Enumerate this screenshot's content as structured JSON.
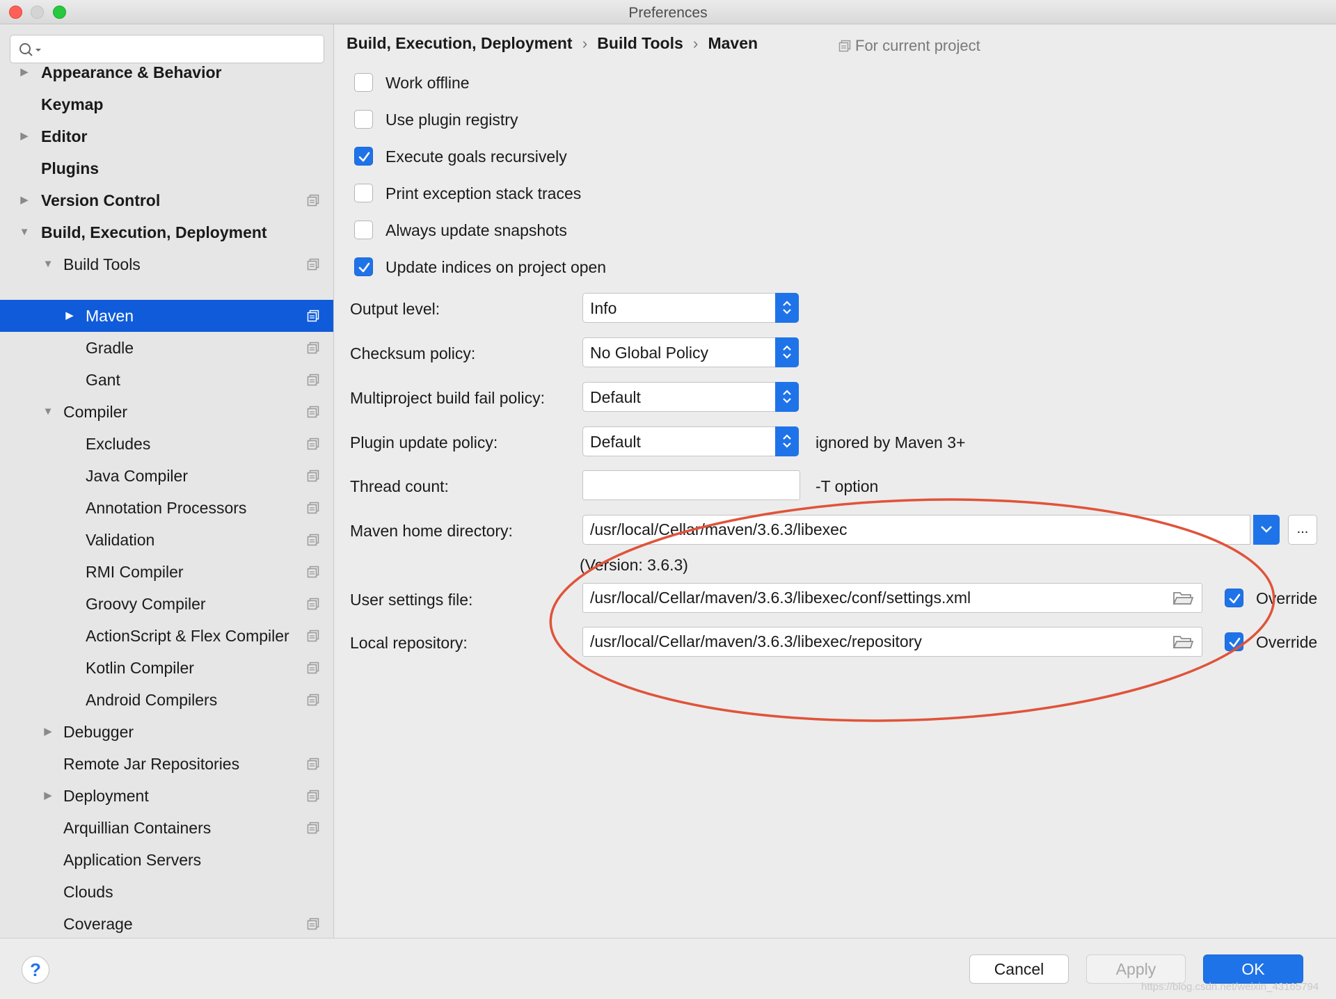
{
  "window": {
    "title": "Preferences"
  },
  "sidebar": {
    "search": {
      "placeholder": ""
    },
    "items": [
      {
        "label": "Appearance & Behavior"
      },
      {
        "label": "Keymap"
      },
      {
        "label": "Editor"
      },
      {
        "label": "Plugins"
      },
      {
        "label": "Version Control"
      },
      {
        "label": "Build, Execution, Deployment"
      },
      {
        "label": "Build Tools"
      },
      {
        "label": "Maven"
      },
      {
        "label": "Gradle"
      },
      {
        "label": "Gant"
      },
      {
        "label": "Compiler"
      },
      {
        "label": "Excludes"
      },
      {
        "label": "Java Compiler"
      },
      {
        "label": "Annotation Processors"
      },
      {
        "label": "Validation"
      },
      {
        "label": "RMI Compiler"
      },
      {
        "label": "Groovy Compiler"
      },
      {
        "label": "ActionScript & Flex Compiler"
      },
      {
        "label": "Kotlin Compiler"
      },
      {
        "label": "Android Compilers"
      },
      {
        "label": "Debugger"
      },
      {
        "label": "Remote Jar Repositories"
      },
      {
        "label": "Deployment"
      },
      {
        "label": "Arquillian Containers"
      },
      {
        "label": "Application Servers"
      },
      {
        "label": "Clouds"
      },
      {
        "label": "Coverage"
      }
    ]
  },
  "breadcrumb": {
    "parts": [
      "Build, Execution, Deployment",
      "Build Tools",
      "Maven"
    ],
    "separator": "›",
    "scope": "For current project"
  },
  "options": [
    {
      "label": "Work offline",
      "checked": false
    },
    {
      "label": "Use plugin registry",
      "checked": false
    },
    {
      "label": "Execute goals recursively",
      "checked": true
    },
    {
      "label": "Print exception stack traces",
      "checked": false
    },
    {
      "label": "Always update snapshots",
      "checked": false
    },
    {
      "label": "Update indices on project open",
      "checked": true
    }
  ],
  "form": {
    "output_level": {
      "label": "Output level:",
      "value": "Info"
    },
    "checksum_policy": {
      "label": "Checksum policy:",
      "value": "No Global Policy"
    },
    "fail_policy": {
      "label": "Multiproject build fail policy:",
      "value": "Default"
    },
    "plugin_update": {
      "label": "Plugin update policy:",
      "value": "Default",
      "hint": "ignored by Maven 3+"
    },
    "thread_count": {
      "label": "Thread count:",
      "value": "",
      "hint": "-T option"
    },
    "maven_home": {
      "label": "Maven home directory:",
      "value": "/usr/local/Cellar/maven/3.6.3/libexec",
      "more": "...",
      "version": "(Version: 3.6.3)"
    },
    "user_settings": {
      "label": "User settings file:",
      "value": "/usr/local/Cellar/maven/3.6.3/libexec/conf/settings.xml",
      "override_label": "Override",
      "override_checked": true
    },
    "local_repo": {
      "label": "Local repository:",
      "value": "/usr/local/Cellar/maven/3.6.3/libexec/repository",
      "override_label": "Override",
      "override_checked": true
    }
  },
  "buttons": {
    "help": "?",
    "cancel": "Cancel",
    "apply": "Apply",
    "ok": "OK"
  },
  "watermark": "https://blog.csdn.net/weixin_43165794",
  "colors": {
    "accent": "#1f73e8",
    "selection": "#0f5bd9",
    "annotation": "#e0533a"
  }
}
